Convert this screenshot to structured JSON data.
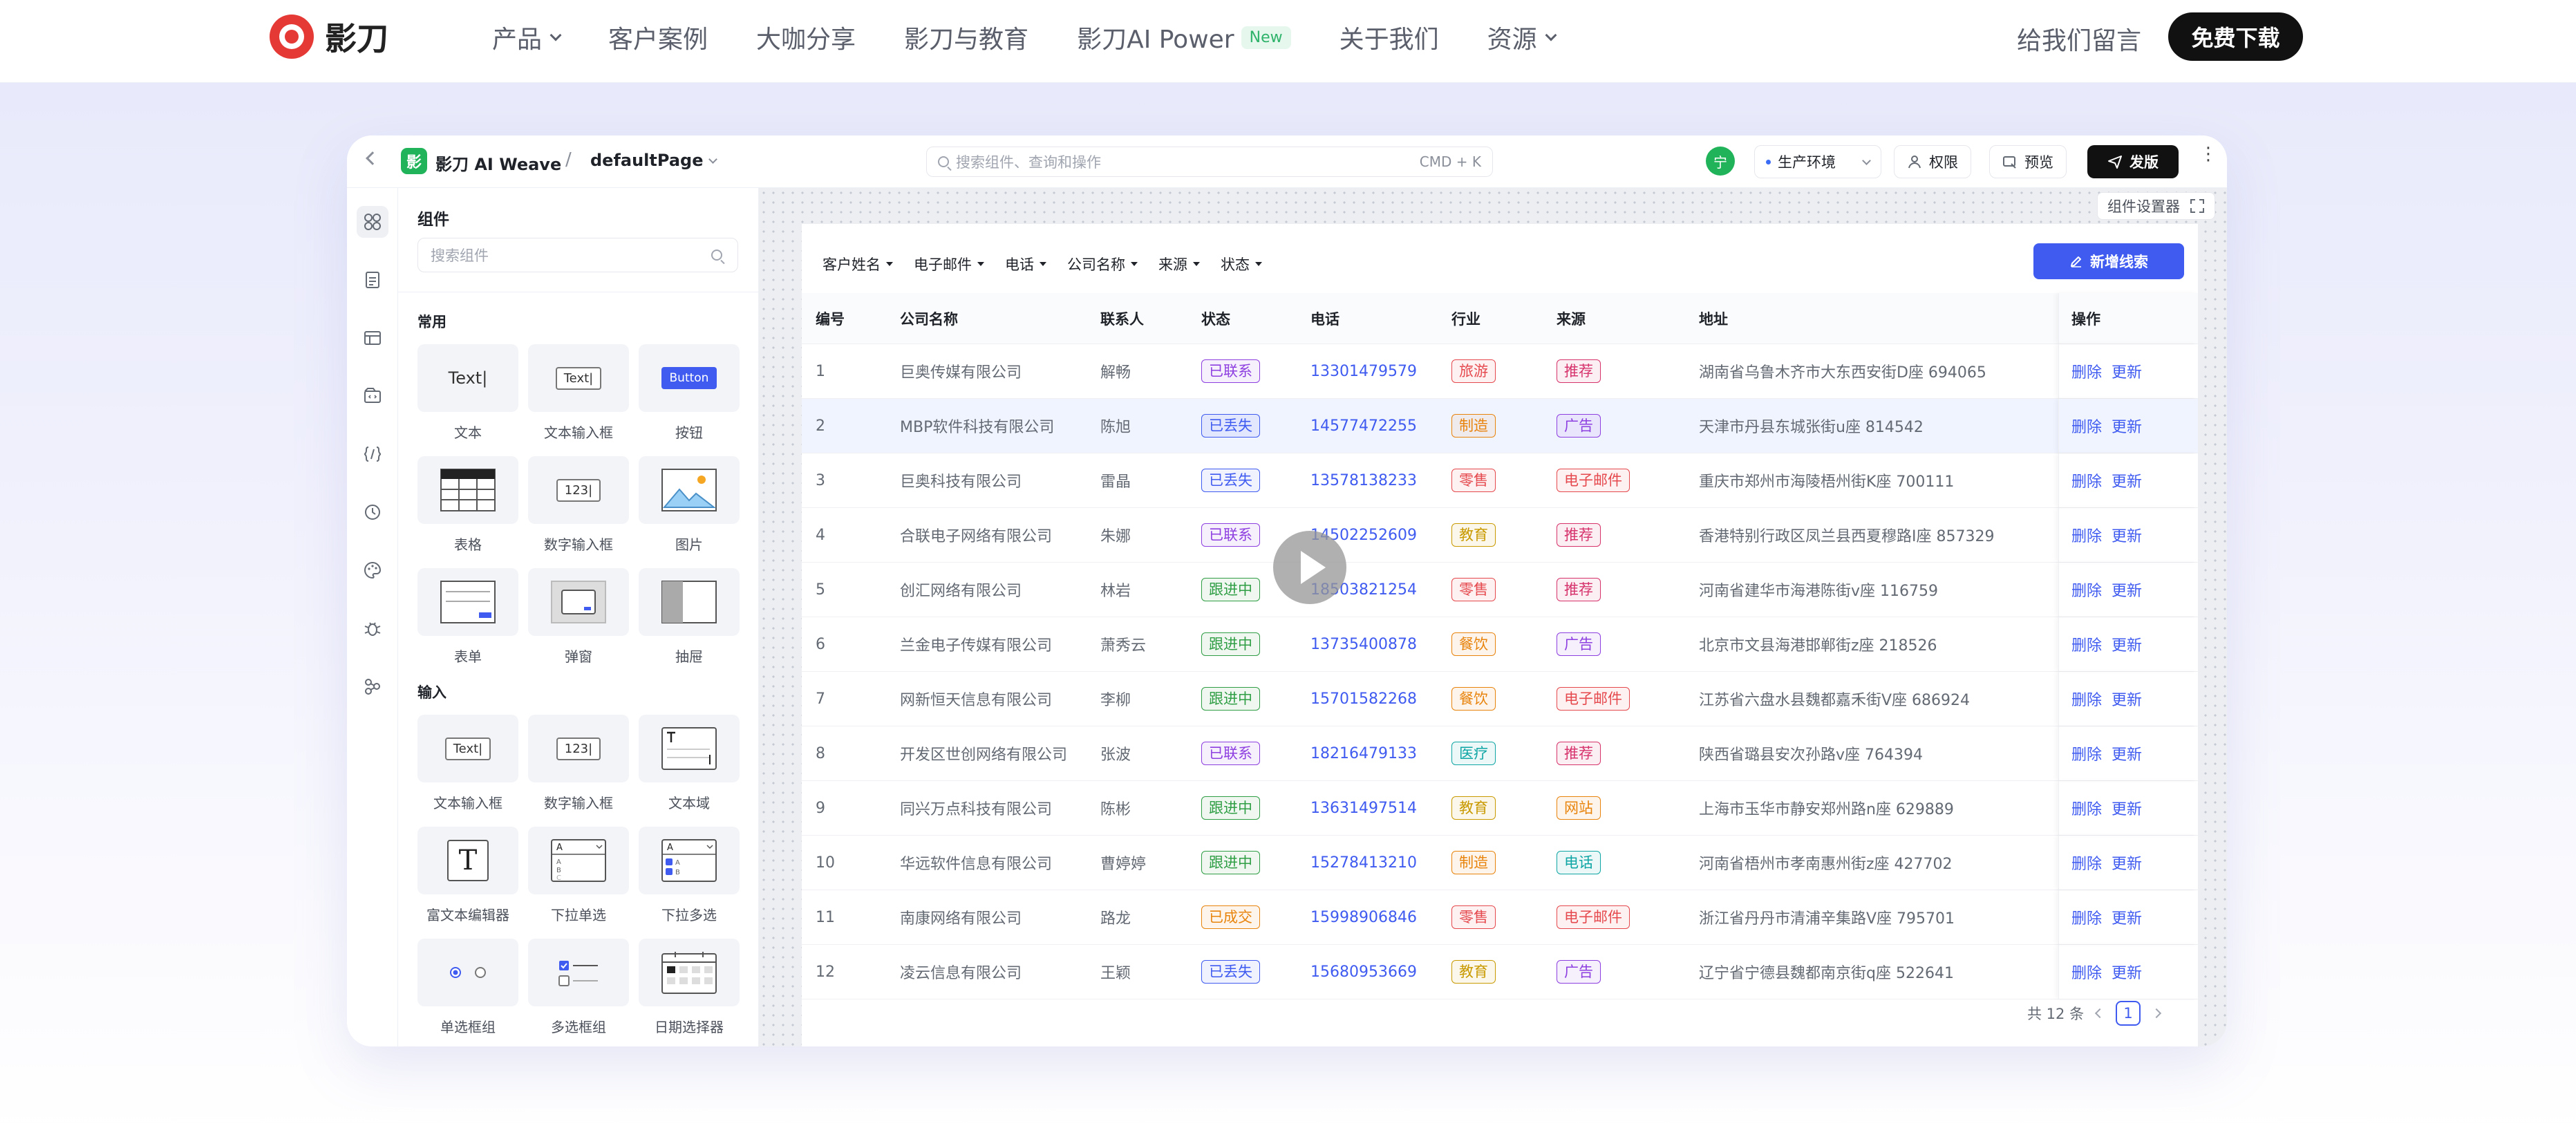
{
  "site": {
    "brand": "影刀",
    "nav": [
      {
        "label": "产品",
        "dropdown": true
      },
      {
        "label": "客户案例",
        "dropdown": false
      },
      {
        "label": "大咖分享",
        "dropdown": false
      },
      {
        "label": "影刀与教育",
        "dropdown": false
      },
      {
        "label": "影刀AI Power",
        "dropdown": false,
        "badge": "New"
      },
      {
        "label": "关于我们",
        "dropdown": false
      },
      {
        "label": "资源",
        "dropdown": true
      }
    ],
    "message_link": "给我们留言",
    "download_button": "免费下载"
  },
  "app": {
    "logo_char": "影",
    "title": "影刀 AI Weave",
    "separator": "/",
    "page_name": "defaultPage",
    "search_placeholder": "搜索组件、查询和操作",
    "search_shortcut": "CMD + K",
    "avatar_char": "宁",
    "environment": "生产环境",
    "permissions_button": "权限",
    "preview_button": "预览",
    "publish_button": "发版"
  },
  "rail_icons": [
    "components-icon",
    "pages-icon",
    "table-icon",
    "data-source-icon",
    "code-icon",
    "history-icon",
    "theme-icon",
    "debug-icon",
    "integration-icon"
  ],
  "panel": {
    "title": "组件",
    "search_placeholder": "搜索组件",
    "sections": [
      {
        "title": "常用",
        "items": [
          "文本",
          "文本输入框",
          "按钮",
          "表格",
          "数字输入框",
          "图片",
          "表单",
          "弹窗",
          "抽屉"
        ]
      },
      {
        "title": "输入",
        "items": [
          "文本输入框",
          "数字输入框",
          "文本域",
          "富文本编辑器",
          "下拉单选",
          "下拉多选",
          "单选框组",
          "多选框组",
          "日期选择器"
        ]
      }
    ],
    "thumb_text": {
      "text": "Text",
      "input": "Text",
      "button": "Button",
      "number": "123",
      "rich": "T"
    }
  },
  "canvas": {
    "settings_tab": "组件设置器",
    "filters": [
      "客户姓名",
      "电子邮件",
      "电话",
      "公司名称",
      "来源",
      "状态"
    ],
    "add_button": "新增线索",
    "columns": [
      "编号",
      "公司名称",
      "联系人",
      "状态",
      "电话",
      "行业",
      "来源",
      "地址",
      "操作"
    ],
    "rows": [
      {
        "id": "1",
        "company": "巨奥传媒有限公司",
        "contact": "解畅",
        "status": "已联系",
        "phone": "13301479579",
        "industry": "旅游",
        "source": "推荐",
        "address": "湖南省乌鲁木齐市大东西安街D座 694065"
      },
      {
        "id": "2",
        "company": "MBP软件科技有限公司",
        "contact": "陈旭",
        "status": "已丢失",
        "phone": "14577472255",
        "industry": "制造",
        "source": "广告",
        "address": "天津市丹县东城张街u座 814542"
      },
      {
        "id": "3",
        "company": "巨奥科技有限公司",
        "contact": "雷晶",
        "status": "已丢失",
        "phone": "13578138233",
        "industry": "零售",
        "source": "电子邮件",
        "address": "重庆市郑州市海陵梧州街K座 700111"
      },
      {
        "id": "4",
        "company": "合联电子网络有限公司",
        "contact": "朱娜",
        "status": "已联系",
        "phone": "14502252609",
        "industry": "教育",
        "source": "推荐",
        "address": "香港特别行政区凤兰县西夏穆路I座 857329"
      },
      {
        "id": "5",
        "company": "创汇网络有限公司",
        "contact": "林岩",
        "status": "跟进中",
        "phone": "18503821254",
        "industry": "零售",
        "source": "推荐",
        "address": "河南省建华市海港陈街v座 116759"
      },
      {
        "id": "6",
        "company": "兰金电子传媒有限公司",
        "contact": "萧秀云",
        "status": "跟进中",
        "phone": "13735400878",
        "industry": "餐饮",
        "source": "广告",
        "address": "北京市文县海港邯郸街z座 218526"
      },
      {
        "id": "7",
        "company": "网新恒天信息有限公司",
        "contact": "李柳",
        "status": "跟进中",
        "phone": "15701582268",
        "industry": "餐饮",
        "source": "电子邮件",
        "address": "江苏省六盘水县魏都嘉禾街V座 686924"
      },
      {
        "id": "8",
        "company": "开发区世创网络有限公司",
        "contact": "张波",
        "status": "已联系",
        "phone": "18216479133",
        "industry": "医疗",
        "source": "推荐",
        "address": "陕西省璐县安次孙路v座 764394"
      },
      {
        "id": "9",
        "company": "同兴万点科技有限公司",
        "contact": "陈彬",
        "status": "跟进中",
        "phone": "13631497514",
        "industry": "教育",
        "source": "网站",
        "address": "上海市玉华市静安郑州路n座 629889"
      },
      {
        "id": "10",
        "company": "华远软件信息有限公司",
        "contact": "曹婷婷",
        "status": "跟进中",
        "phone": "15278413210",
        "industry": "制造",
        "source": "电话",
        "address": "河南省梧州市孝南惠州街z座 427702"
      },
      {
        "id": "11",
        "company": "南康网络有限公司",
        "contact": "路龙",
        "status": "已成交",
        "phone": "15998906846",
        "industry": "零售",
        "source": "电子邮件",
        "address": "浙江省丹丹市清浦辛集路V座 795701"
      },
      {
        "id": "12",
        "company": "凌云信息有限公司",
        "contact": "王颖",
        "status": "已丢失",
        "phone": "15680953669",
        "industry": "教育",
        "source": "广告",
        "address": "辽宁省宁德县魏都南京街q座 522641"
      }
    ],
    "row_actions": [
      "删除",
      "更新"
    ],
    "pagination": {
      "total_text": "共 12 条",
      "current_page": "1"
    }
  },
  "colors": {
    "accent": "#3f5bf0",
    "brand_red": "#e53935",
    "brand_green": "#21b35a",
    "status": {
      "已联系": "#8e3fe0",
      "已丢失": "#3f5bf0",
      "跟进中": "#2f9e44",
      "已成交": "#e8830c"
    },
    "tag": {
      "旅游": "#e5484d",
      "制造": "#e8830c",
      "零售": "#e5484d",
      "教育": "#c99a00",
      "餐饮": "#e8830c",
      "医疗": "#0ea5a4",
      "推荐": "#d6336c",
      "广告": "#8e3fe0",
      "电子邮件": "#e5484d",
      "网站": "#e8830c",
      "电话": "#0ea5a4"
    }
  }
}
